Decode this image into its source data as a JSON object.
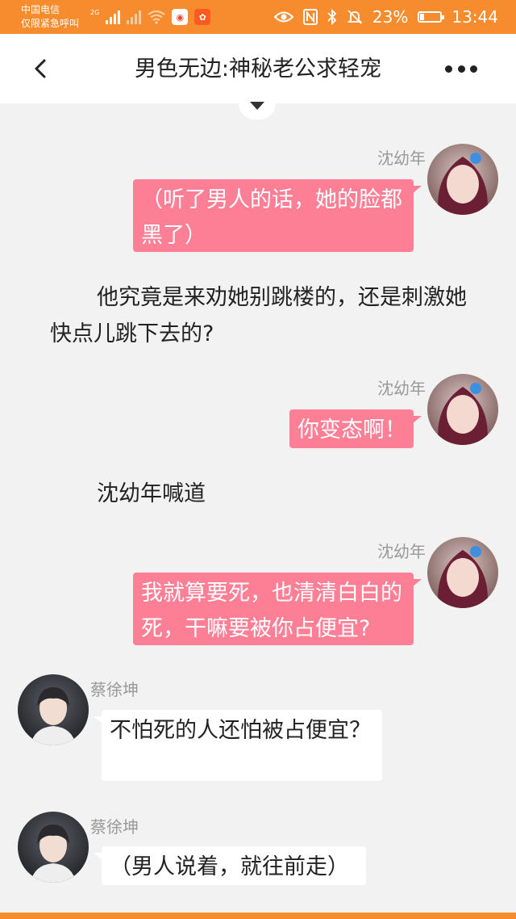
{
  "status_bar": {
    "carrier_line1": "中国电信",
    "carrier_line2": "仅限紧急呼叫",
    "network_tag": "2G",
    "battery_percent": "23%",
    "battery_level": 0.23,
    "time": "13:44",
    "icons": [
      "signal-icon",
      "signal-off-icon",
      "wifi-icon",
      "weibo-app-icon",
      "kuaishou-app-icon",
      "eye-icon",
      "nfc-icon",
      "bluetooth-icon",
      "mute-icon",
      "battery-icon"
    ]
  },
  "nav": {
    "title": "男色无边:神秘老公求轻宠"
  },
  "colors": {
    "status_bar": "#f78c2e",
    "bubble_pink": "#fc7f96",
    "background": "#f2f2f2"
  },
  "messages": [
    {
      "type": "bubble",
      "side": "right",
      "sender": "沈幼年",
      "text": "（听了男人的话，她的脸都黑了）"
    },
    {
      "type": "narration",
      "text": "他究竟是来劝她别跳楼的，还是刺激她快点儿跳下去的?"
    },
    {
      "type": "bubble",
      "side": "right",
      "sender": "沈幼年",
      "text": "你变态啊！"
    },
    {
      "type": "narration",
      "text": "沈幼年喊道"
    },
    {
      "type": "bubble",
      "side": "right",
      "sender": "沈幼年",
      "text": "我就算要死，也清清白白的死，干嘛要被你占便宜?"
    },
    {
      "type": "bubble",
      "side": "left",
      "sender": "蔡徐坤",
      "text": "不怕死的人还怕被占便宜？"
    },
    {
      "type": "bubble",
      "side": "left",
      "sender": "蔡徐坤",
      "text": "（男人说着，就往前走）"
    }
  ]
}
